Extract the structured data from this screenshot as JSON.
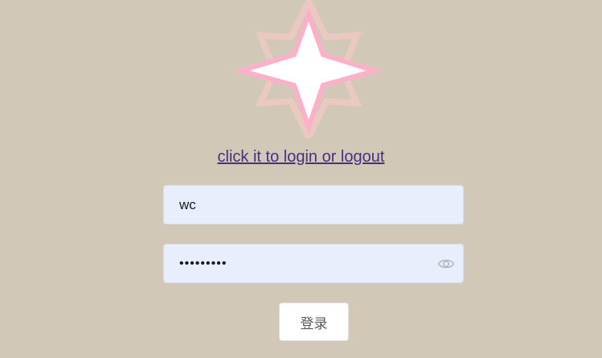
{
  "logo": {
    "icon": "star-icon",
    "colors": {
      "outline": "#e9c9c2",
      "inner": "#ffb0c9",
      "fill": "#ffffff"
    }
  },
  "login_link": {
    "text": "click it to login or logout",
    "color": "#4b2f7f"
  },
  "username": {
    "value": "wc"
  },
  "password": {
    "value": "•••••••••",
    "toggle_icon": "eye-icon"
  },
  "submit": {
    "label": "登录"
  },
  "theme": {
    "background": "#d1c8b8",
    "field_bg": "#e8eefb"
  }
}
